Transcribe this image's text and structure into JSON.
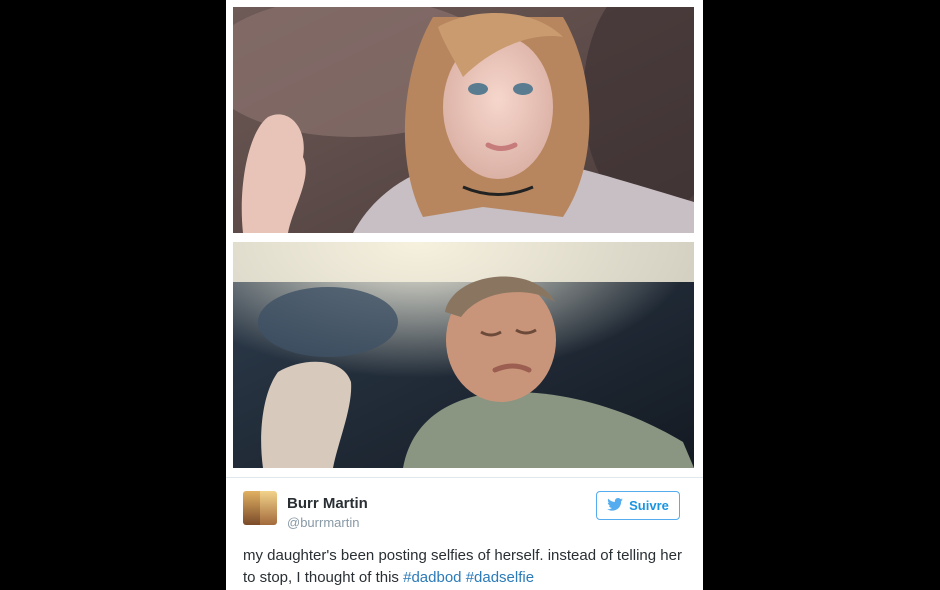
{
  "tweet": {
    "author_name": "Burr Martin",
    "author_handle": "@burrmartin",
    "follow_label": "Suivre",
    "text_plain": "my daughter's been posting selfies of herself. instead of telling her to stop, I thought of this ",
    "hashtags": [
      "#dadbod",
      "#dadselfie"
    ]
  },
  "icons": {
    "follow": "twitter-bird-icon"
  },
  "colors": {
    "background": "#000000",
    "card": "#ffffff",
    "accent": "#1b95e0",
    "hashtag": "#2b7bb9",
    "text": "#292f33",
    "muted": "#8899a6"
  }
}
